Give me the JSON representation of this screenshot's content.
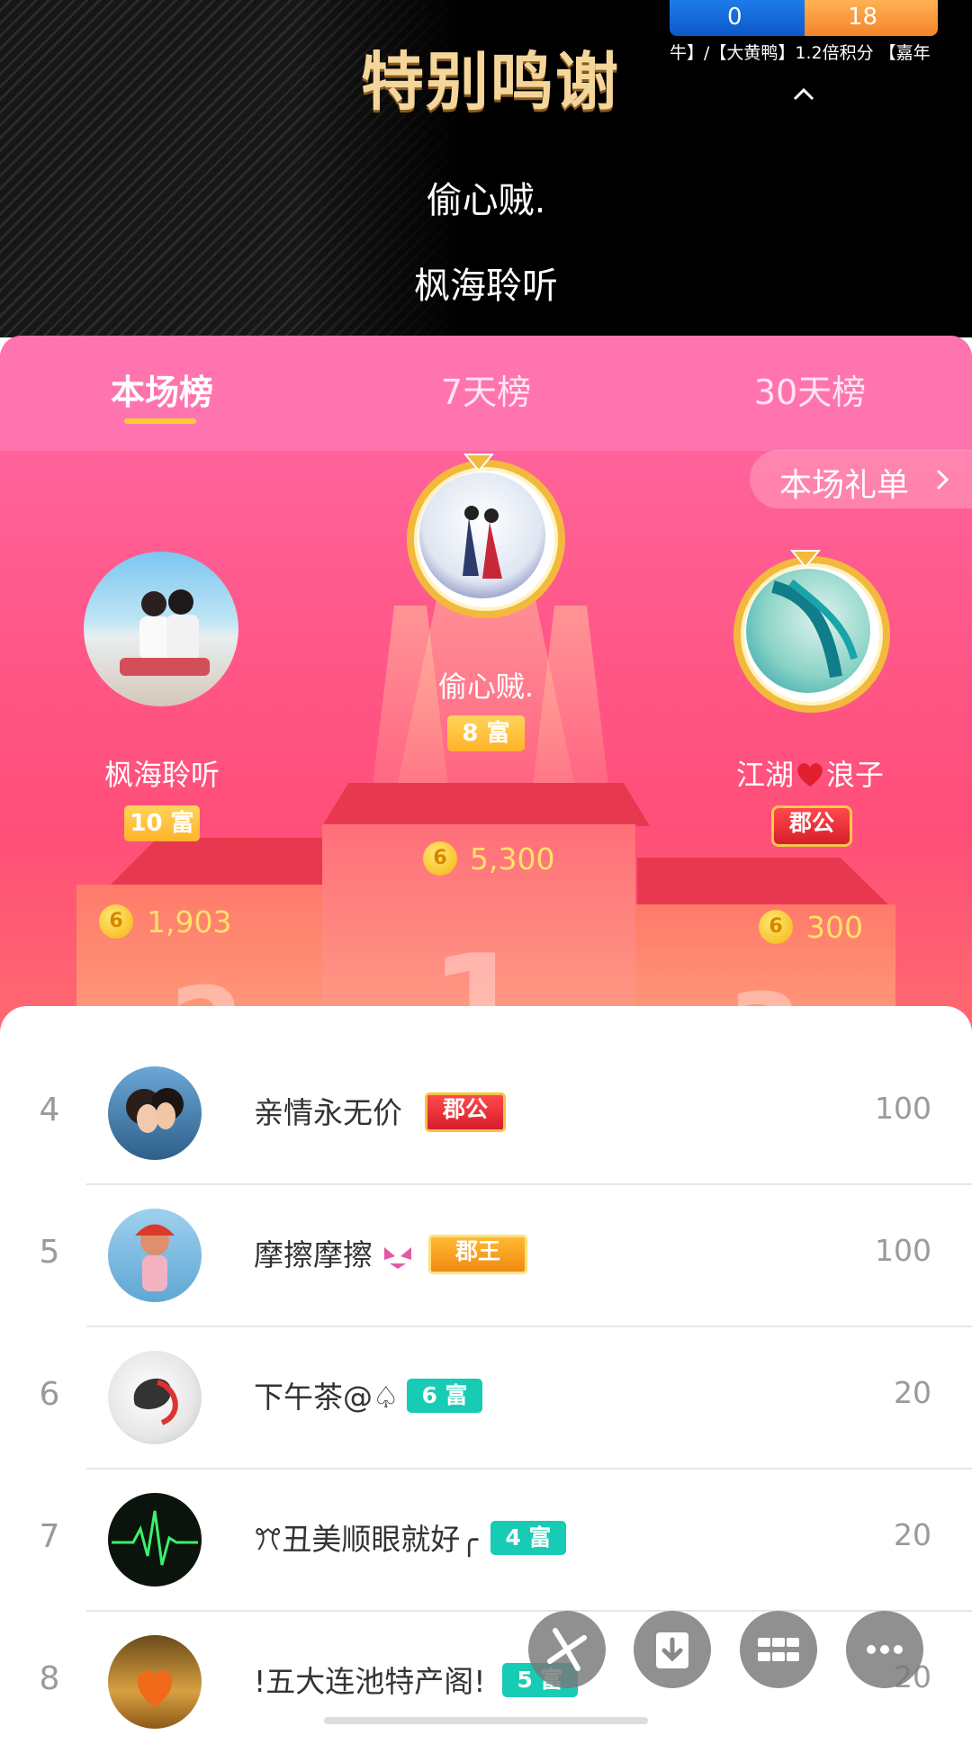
{
  "header": {
    "title": "特别鸣谢",
    "score_left": "0",
    "score_right": "18",
    "ticker": "牛】/【大黄鸭】1.2倍积分 【嘉年",
    "thanks": [
      "偷心贼.",
      "枫海聆听"
    ]
  },
  "tabs": [
    {
      "label": "本场榜",
      "active": true
    },
    {
      "label": "7天榜",
      "active": false
    },
    {
      "label": "30天榜",
      "active": false
    }
  ],
  "gift_list_label": "本场礼单",
  "podium": {
    "first": {
      "name": "偷心贼.",
      "badge": "8 富",
      "score": "5,300",
      "number": "1"
    },
    "second": {
      "name": "枫海聆听",
      "badge": "10 富",
      "score": "1,903",
      "number": "2"
    },
    "third": {
      "name_left": "江湖",
      "name_right": "浪子",
      "badge": "郡公",
      "score": "300",
      "number": "3"
    }
  },
  "coin_symbol": "6",
  "ranking": [
    {
      "rank": "4",
      "name": "亲情永无价",
      "badge": "郡公",
      "badge_style": "red",
      "value": "100"
    },
    {
      "rank": "5",
      "name": "摩擦摩擦",
      "badge": "郡王",
      "badge_style": "gold",
      "value": "100"
    },
    {
      "rank": "6",
      "name": "下午茶@♤",
      "badge": "6 富",
      "badge_style": "teal",
      "value": "20"
    },
    {
      "rank": "7",
      "name": "ꔫ丑美顺眼就好╭",
      "badge": "4 富",
      "badge_style": "teal",
      "value": "20"
    },
    {
      "rank": "8",
      "name": "!五大连池特产阁!",
      "badge": "5 富",
      "badge_style": "teal",
      "value": "20"
    }
  ],
  "colors": {
    "accent_pink": "#ff5a8e",
    "gold": "#ffcd3a",
    "teal": "#17cbb4"
  },
  "fab_icons": [
    "pinwheel-icon",
    "download-icon",
    "grid-icon",
    "more-icon"
  ]
}
